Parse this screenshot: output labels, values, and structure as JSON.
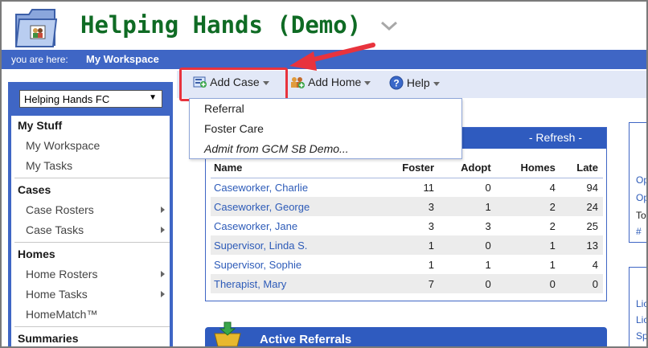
{
  "header": {
    "app_title": "Helping Hands (Demo)",
    "breadcrumb_label": "you are here:",
    "breadcrumb_value": "My Workspace"
  },
  "sidebar": {
    "org_select": "Helping Hands FC",
    "sections": [
      {
        "title": "My Stuff",
        "items": [
          {
            "label": "My Workspace"
          },
          {
            "label": "My Tasks"
          }
        ]
      },
      {
        "title": "Cases",
        "items": [
          {
            "label": "Case Rosters"
          },
          {
            "label": "Case Tasks"
          }
        ]
      },
      {
        "title": "Homes",
        "items": [
          {
            "label": "Home Rosters"
          },
          {
            "label": "Home Tasks"
          },
          {
            "label": "HomeMatch™"
          }
        ]
      },
      {
        "title": "Summaries"
      }
    ]
  },
  "toolbar": {
    "add_case": "Add Case",
    "add_home": "Add Home",
    "help": "Help"
  },
  "add_case_menu": [
    "Referral",
    "Foster Care",
    "Admit from GCM SB Demo..."
  ],
  "caseload": {
    "refresh": "- Refresh -",
    "columns": [
      "Name",
      "Foster",
      "Adopt",
      "Homes",
      "Late"
    ],
    "rows": [
      [
        "Caseworker, Charlie",
        "11",
        "0",
        "4",
        "94"
      ],
      [
        "Caseworker, George",
        "3",
        "1",
        "2",
        "24"
      ],
      [
        "Caseworker, Jane",
        "3",
        "3",
        "2",
        "25"
      ],
      [
        "Supervisor, Linda S.",
        "1",
        "0",
        "1",
        "13"
      ],
      [
        "Supervisor, Sophie",
        "1",
        "1",
        "1",
        "4"
      ],
      [
        "Therapist, Mary",
        "7",
        "0",
        "0",
        "0"
      ]
    ]
  },
  "referrals": {
    "title": "Active Referrals"
  },
  "right_widgets": {
    "top_lines": [
      "Op",
      "Op",
      "To",
      "#"
    ],
    "bottom_lines": [
      "Lic",
      "Lic",
      "Sp"
    ]
  },
  "colors": {
    "brand_green": "#0f6b24",
    "nav_blue": "#3f66c5",
    "link_blue": "#2d5bb8",
    "highlight_red": "#e8333d"
  }
}
